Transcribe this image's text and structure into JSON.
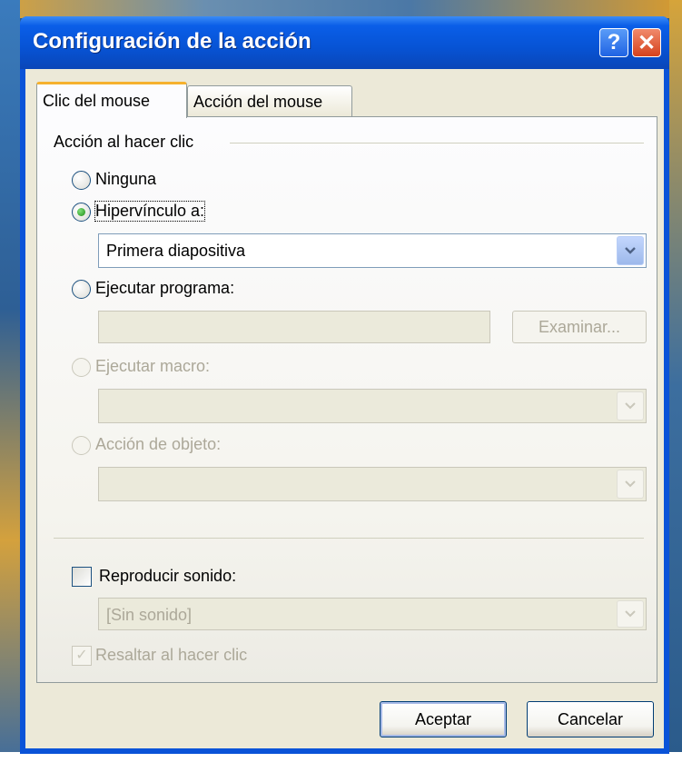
{
  "window": {
    "title": "Configuración de la acción"
  },
  "titlebar": {
    "help_glyph": "?",
    "close_glyph": "✕"
  },
  "tabs": [
    {
      "label": "Clic del mouse",
      "active": true
    },
    {
      "label": "Acción del mouse",
      "active": false
    }
  ],
  "group": {
    "label": "Acción al hacer clic"
  },
  "options": {
    "none": {
      "label": "Ninguna",
      "selected": false,
      "enabled": true
    },
    "hyperlink": {
      "label": "Hipervínculo a:",
      "selected": true,
      "enabled": true,
      "value": "Primera diapositiva"
    },
    "run_program": {
      "label": "Ejecutar programa:",
      "selected": false,
      "enabled": true,
      "value": "",
      "browse_label": "Examinar..."
    },
    "run_macro": {
      "label": "Ejecutar macro:",
      "selected": false,
      "enabled": false,
      "value": ""
    },
    "object_action": {
      "label": "Acción de objeto:",
      "selected": false,
      "enabled": false,
      "value": ""
    }
  },
  "sound": {
    "label": "Reproducir sonido:",
    "checked": false,
    "value": "[Sin sonido]"
  },
  "highlight": {
    "label": "Resaltar al hacer clic",
    "checked": true,
    "enabled": false
  },
  "buttons": {
    "ok_label": "Aceptar",
    "cancel_label": "Cancelar"
  },
  "colors": {
    "titlebar": "#0753d4",
    "dialog_bg": "#ece9d8",
    "tab_accent": "#f5b12e",
    "radio_dot": "#1f8c16"
  }
}
